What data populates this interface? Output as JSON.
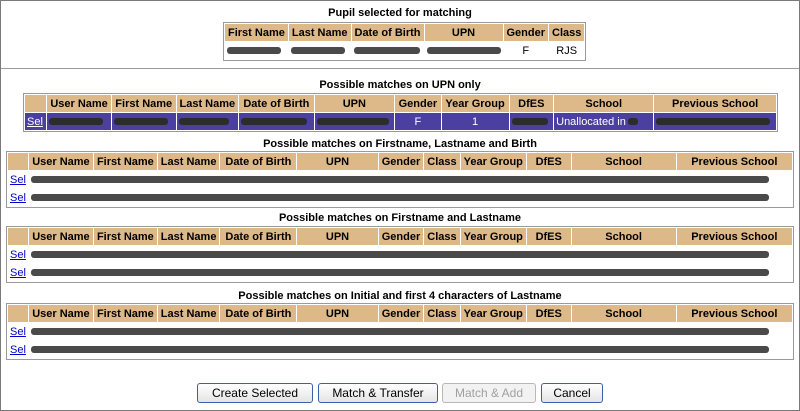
{
  "pupil": {
    "title": "Pupil selected for matching",
    "headers": [
      "First Name",
      "Last Name",
      "Date of Birth",
      "UPN",
      "Gender",
      "Class"
    ],
    "row": {
      "gender": "F",
      "class": "RJS"
    }
  },
  "upn_section": {
    "title": "Possible matches on UPN only",
    "headers": [
      "",
      "User Name",
      "First Name",
      "Last Name",
      "Date of Birth",
      "UPN",
      "Gender",
      "Year Group",
      "DfES",
      "School",
      "Previous School"
    ],
    "row": {
      "sel": "Sel",
      "gender": "F",
      "year_group": "1",
      "school": "Unallocated in"
    }
  },
  "firstname_lastname_birth": {
    "title": "Possible matches on Firstname, Lastname and Birth",
    "headers": [
      "",
      "User Name",
      "First Name",
      "Last Name",
      "Date of Birth",
      "UPN",
      "Gender",
      "Class",
      "Year Group",
      "DfES",
      "School",
      "Previous School"
    ],
    "rows": [
      {
        "sel": "Sel"
      },
      {
        "sel": "Sel"
      }
    ]
  },
  "firstname_lastname": {
    "title": "Possible matches on Firstname and Lastname",
    "headers": [
      "",
      "User Name",
      "First Name",
      "Last Name",
      "Date of Birth",
      "UPN",
      "Gender",
      "Class",
      "Year Group",
      "DfES",
      "School",
      "Previous School"
    ],
    "rows": [
      {
        "sel": "Sel"
      },
      {
        "sel": "Sel"
      }
    ]
  },
  "initial_lastname": {
    "title": "Possible matches on Initial and first 4 characters of Lastname",
    "headers": [
      "",
      "User Name",
      "First Name",
      "Last Name",
      "Date of Birth",
      "UPN",
      "Gender",
      "Class",
      "Year Group",
      "DfES",
      "School",
      "Previous School"
    ],
    "rows": [
      {
        "sel": "Sel"
      },
      {
        "sel": "Sel"
      }
    ]
  },
  "buttons": {
    "create_selected": "Create Selected",
    "match_transfer": "Match & Transfer",
    "match_add": "Match & Add",
    "cancel": "Cancel"
  },
  "colors": {
    "header_bg": "#ddb989",
    "selected_row_bg": "#4b3fa0",
    "link": "#0000cc"
  }
}
